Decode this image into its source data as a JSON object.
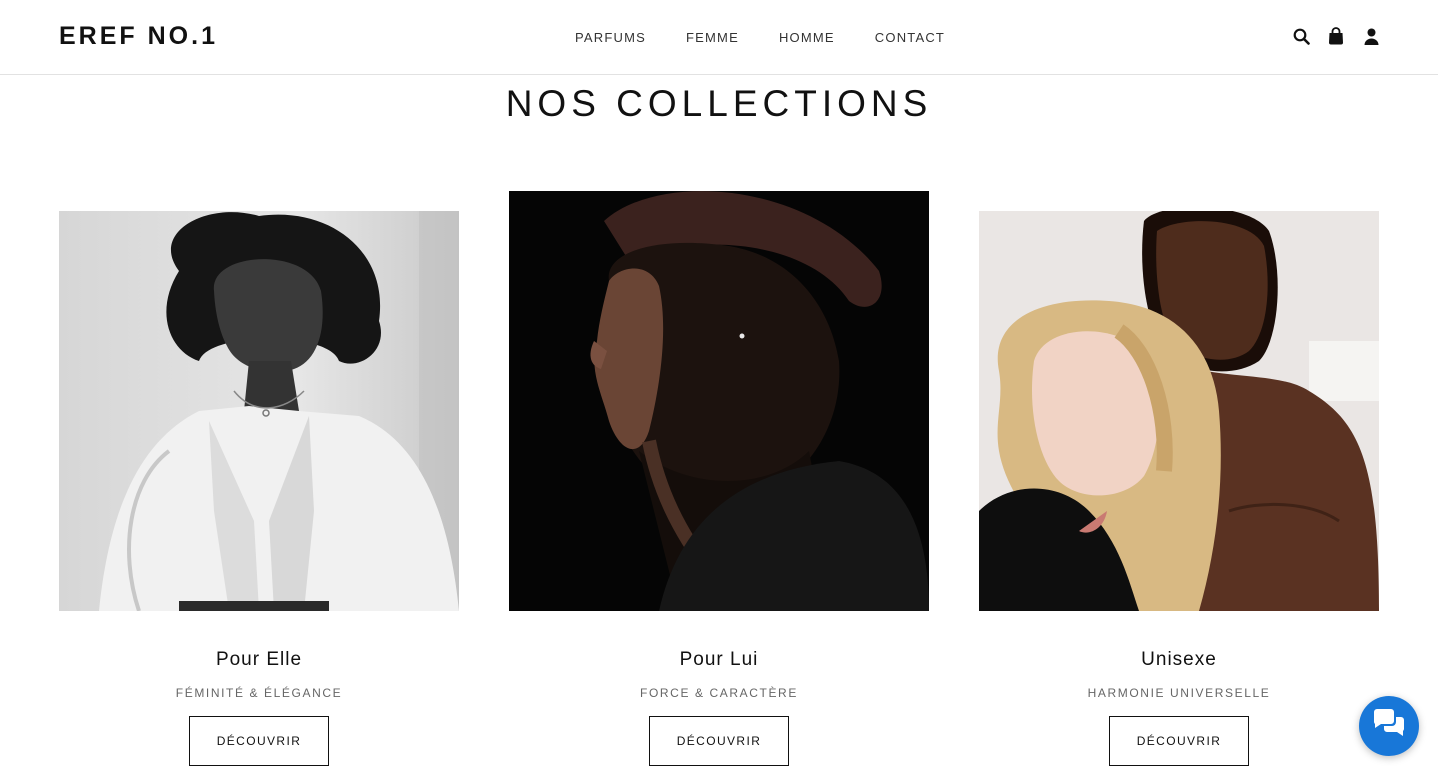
{
  "brand": {
    "name": "EREF NO.1"
  },
  "nav": {
    "items": [
      {
        "label": "PARFUMS"
      },
      {
        "label": "FEMME"
      },
      {
        "label": "HOMME"
      },
      {
        "label": "CONTACT"
      }
    ]
  },
  "header_icons": [
    "search-icon",
    "shopping-bag-icon",
    "user-icon"
  ],
  "section": {
    "title": "NOS COLLECTIONS"
  },
  "collections": [
    {
      "name": "Pour Elle",
      "tagline": "FÉMINITÉ & ÉLÉGANCE",
      "cta": "DÉCOUVRIR"
    },
    {
      "name": "Pour Lui",
      "tagline": "FORCE & CARACTÈRE",
      "cta": "DÉCOUVRIR"
    },
    {
      "name": "Unisexe",
      "tagline": "HARMONIE UNIVERSELLE",
      "cta": "DÉCOUVRIR"
    }
  ],
  "chat": {
    "icon": "chat-bubbles-icon",
    "color": "#1877d8"
  }
}
